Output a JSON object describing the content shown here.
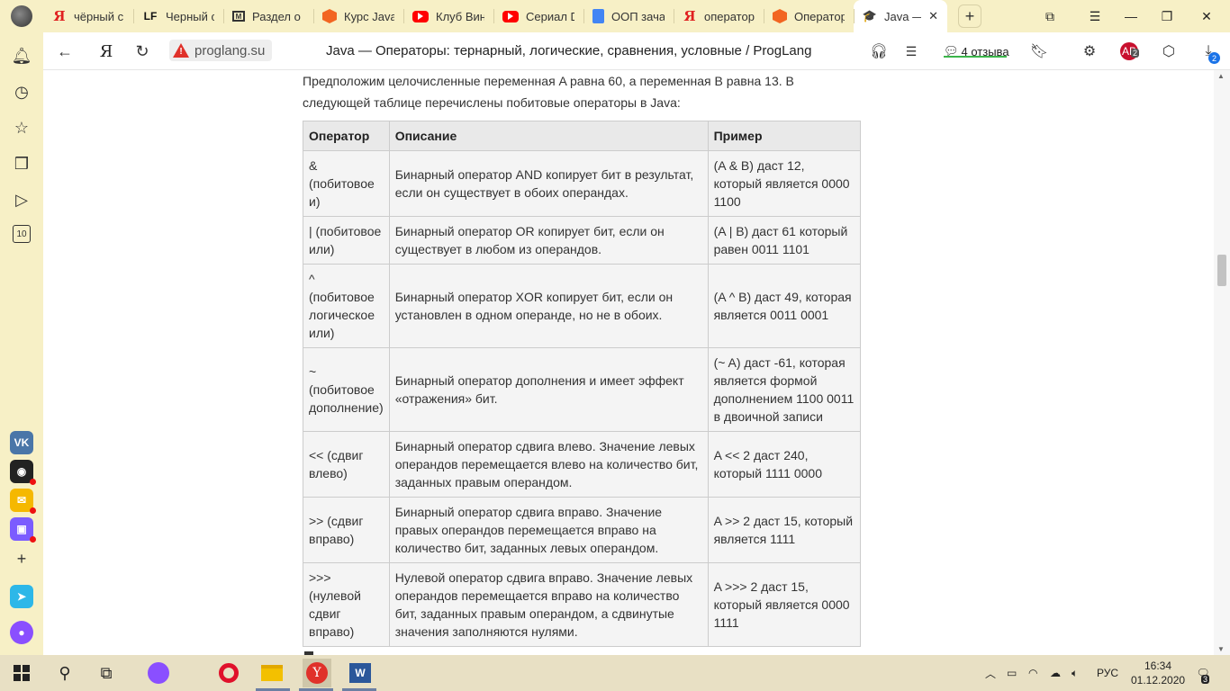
{
  "tabs": [
    {
      "label": "чёрный с",
      "icon": "yandex-favicon-icon"
    },
    {
      "label": "Черный с",
      "icon": "lf-favicon-icon"
    },
    {
      "label": "Раздел о",
      "icon": "m-favicon-icon"
    },
    {
      "label": "Курс Java",
      "icon": "hexlet-favicon-icon"
    },
    {
      "label": "Клуб Вин",
      "icon": "youtube-favicon-icon"
    },
    {
      "label": "Сериал D",
      "icon": "youtube-favicon-icon"
    },
    {
      "label": "ООП зача",
      "icon": "docs-favicon-icon"
    },
    {
      "label": "оператор",
      "icon": "yandex-favicon-icon"
    },
    {
      "label": "Операторы",
      "icon": "hexlet-favicon-icon"
    },
    {
      "label": "Java —",
      "icon": "graduation-cap-icon",
      "active": true
    }
  ],
  "sidebar": {
    "counter_label": "10"
  },
  "addressbar": {
    "host": "proglang.su",
    "title": "Java — Операторы: тернарный, логические, сравнения, условные / ProgLang",
    "reviews": "4 отзыва",
    "adblock_count": "2",
    "downloads_count": "2"
  },
  "content": {
    "intro": "Предположим целочисленные переменная A равна 60, а переменная B равна 13. В следующей таблице перечислены побитовые операторы в Java:",
    "table": {
      "headers": [
        "Оператор",
        "Описание",
        "Пример"
      ],
      "rows": [
        [
          "& (побитовое и)",
          "Бинарный оператор AND копирует бит в результат, если он существует в обоих операндах.",
          "(A & B) даст 12, который является 0000 1100"
        ],
        [
          "| (побитовое или)",
          "Бинарный оператор OR копирует бит, если он существует в любом из операндов.",
          "(A | B) даст 61 который равен 0011 1101"
        ],
        [
          "^ (побитовое логическое или)",
          "Бинарный оператор XOR копирует бит, если он установлен в одном операнде, но не в обоих.",
          "(A ^ B) даст 49, которая является 0011 0001"
        ],
        [
          "~ (побитовое дополнение)",
          "Бинарный оператор дополнения и имеет эффект «отражения» бит.",
          "(~ A) даст -61, которая является формой дополнением 1100 0011 в двоичной записи"
        ],
        [
          "<< (сдвиг влево)",
          "Бинарный оператор сдвига влево. Значение левых операндов перемещается влево на количество бит, заданных правым операндом.",
          "A << 2 даст 240, который 1111 0000"
        ],
        [
          ">> (сдвиг вправо)",
          "Бинарный оператор сдвига вправо. Значение правых операндов перемещается вправо на количество бит, заданных левых операндом.",
          "A >> 2 даст 15, который является 1111"
        ],
        [
          ">>> (нулевой сдвиг вправо)",
          "Нулевой оператор сдвига вправо. Значение левых операндов перемещается вправо на количество бит, заданных правым операндом, а сдвинутые значения заполняются нулями.",
          "A >>> 2 даст 15, который является 0000 1111"
        ]
      ]
    }
  },
  "taskbar": {
    "language": "РУС",
    "time": "16:34",
    "date": "01.12.2020",
    "notifications": "3"
  },
  "colors": {
    "browser_chrome": "#f7f0c6",
    "taskbar": "#e8e0c4",
    "table_header": "#e9e9e9",
    "table_cell": "#f4f4f4"
  }
}
